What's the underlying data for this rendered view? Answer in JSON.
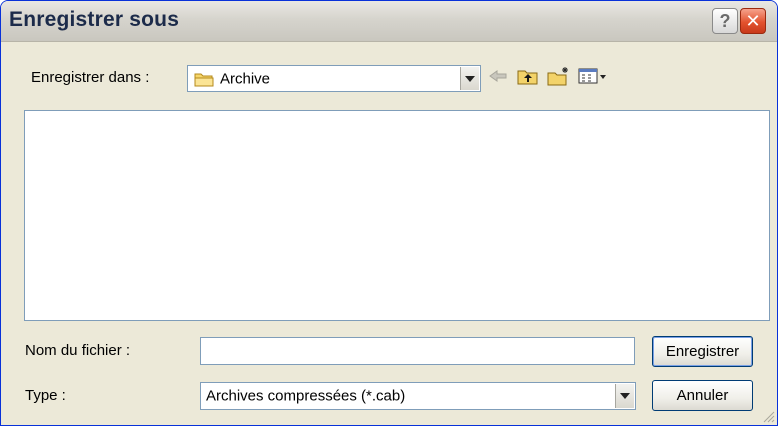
{
  "window": {
    "title": "Enregistrer sous",
    "help_label": "?",
    "close_label": "✕"
  },
  "save_in": {
    "label": "Enregistrer dans :",
    "value": "Archive",
    "icon": "folder-icon"
  },
  "toolbar": {
    "icons": [
      "back-arrow-icon",
      "up-folder-icon",
      "new-folder-icon",
      "view-menu-icon"
    ]
  },
  "filename": {
    "label": "Nom du fichier :",
    "value": "",
    "placeholder": ""
  },
  "filetype": {
    "label": "Type :",
    "value": "Archives compressées (*.cab)"
  },
  "buttons": {
    "save": "Enregistrer",
    "cancel": "Annuler"
  }
}
